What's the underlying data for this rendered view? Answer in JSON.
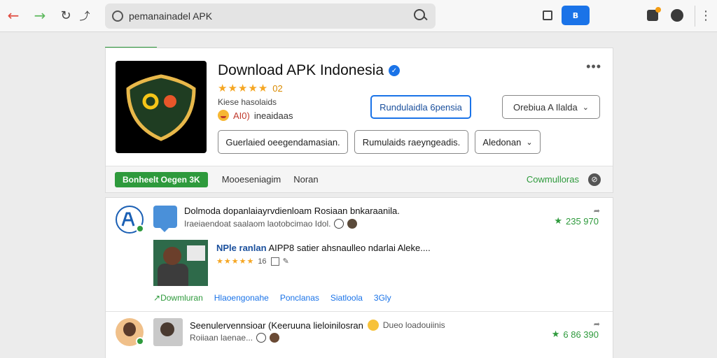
{
  "browser": {
    "address_text": "pemanainadel APK",
    "extension_label": "B"
  },
  "app": {
    "title": "Download APK Indonesia",
    "rating": "02",
    "subtitle": "Kiese hasolaids",
    "age_label": "AI0)",
    "age_sub": "ineaidaas",
    "primary_button": "Rundulaidla 6pensia",
    "dropdown_button": "Orebiua A Ilalda",
    "button_a": "Guerlaied oeegendamasian.",
    "button_b": "Rumulaids raeyngeadis.",
    "button_c": "Aledonan",
    "footer_badge": "Bonheelt Oegen 3K",
    "footer_text1": "Mooeseniagim",
    "footer_text2": "Noran",
    "footer_right": "Cowmulloras"
  },
  "feed": {
    "post1": {
      "title": "Dolmoda dopanlaiayrvdienloam Rosiaan bnkaraanila.",
      "sub": "Iraeiaendoat saalaom laotobcimao Idol.",
      "score": "235 970",
      "sub_title_highlight": "NPle ranlan",
      "sub_title_rest": "AIPP8 satier ahsnaulleo ndarlai Aleke....",
      "sub_rating": "16",
      "links": {
        "download": "Dowmluran",
        "l2": "Hlaoengonahe",
        "l3": "Ponclanas",
        "l4": "Siatloola",
        "l5": "3Gly"
      }
    },
    "post2": {
      "title": "Seenulervennsioar (Keeruuna lieloinilosran",
      "muted": "Dueo loadouiinis",
      "sub": "Roiiaan laenae...",
      "score": "6 86 390"
    }
  }
}
